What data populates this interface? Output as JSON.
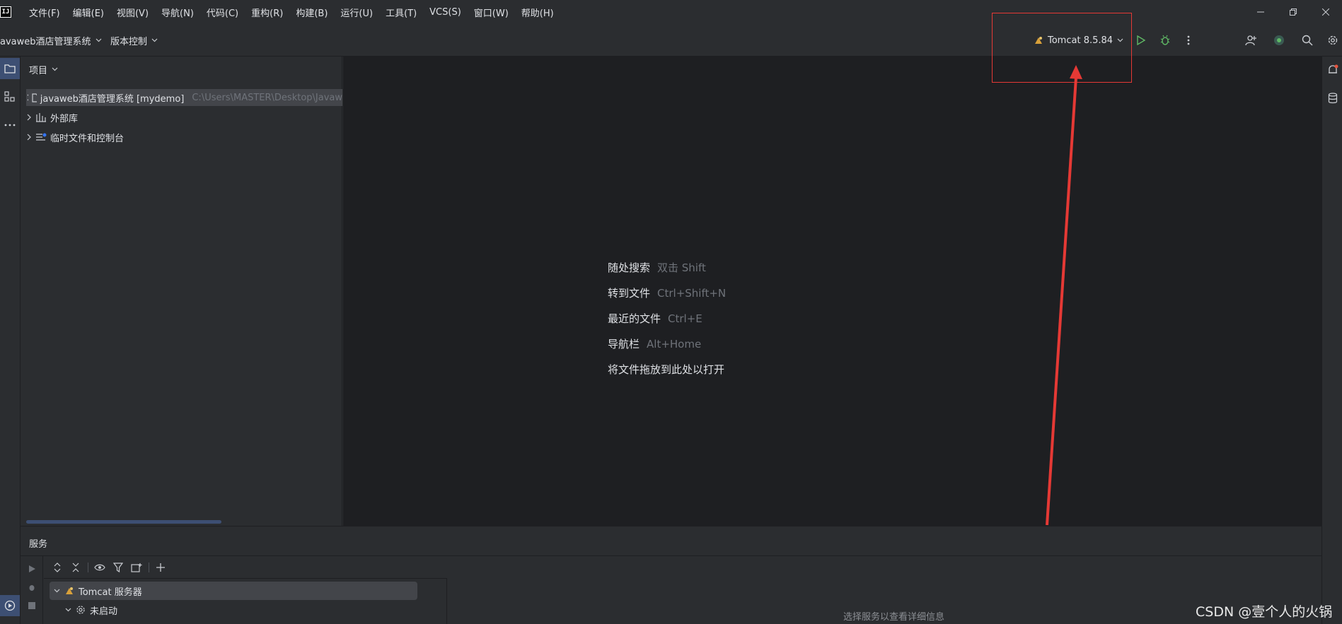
{
  "app": {
    "logo": "IJ"
  },
  "menu": [
    {
      "label": "文件(F)"
    },
    {
      "label": "编辑(E)"
    },
    {
      "label": "视图(V)"
    },
    {
      "label": "导航(N)"
    },
    {
      "label": "代码(C)"
    },
    {
      "label": "重构(R)"
    },
    {
      "label": "构建(B)"
    },
    {
      "label": "运行(U)"
    },
    {
      "label": "工具(T)"
    },
    {
      "label": "VCS(S)"
    },
    {
      "label": "窗口(W)"
    },
    {
      "label": "帮助(H)"
    }
  ],
  "toolbar": {
    "project_name": "avaweb酒店管理系统",
    "vcs_label": "版本控制",
    "run_config": "Tomcat 8.5.84",
    "icons": [
      "run-icon",
      "debug-icon",
      "more-icon",
      "add-user-icon",
      "code-with-me-icon",
      "search-icon",
      "settings-icon"
    ]
  },
  "project_panel": {
    "title": "项目",
    "tree": [
      {
        "label": "javaweb酒店管理系统 [mydemo]",
        "path": "C:\\Users\\MASTER\\Desktop\\Javaw",
        "icon": "module-folder-icon"
      },
      {
        "label": "外部库",
        "icon": "library-icon"
      },
      {
        "label": "临时文件和控制台",
        "icon": "scratches-icon"
      }
    ]
  },
  "editor": {
    "hints": [
      {
        "label": "随处搜索",
        "key": "双击 Shift"
      },
      {
        "label": "转到文件",
        "key": "Ctrl+Shift+N"
      },
      {
        "label": "最近的文件",
        "key": "Ctrl+E"
      },
      {
        "label": "导航栏",
        "key": "Alt+Home"
      },
      {
        "label": "将文件拖放到此处以打开",
        "key": ""
      }
    ]
  },
  "services": {
    "title": "服务",
    "tree": [
      {
        "label": "Tomcat 服务器",
        "icon": "tomcat-icon"
      },
      {
        "label": "未启动",
        "icon": "gear-icon"
      }
    ],
    "detail_placeholder": "选择服务以查看详细信息"
  },
  "watermark": "CSDN @壹个人的火锅",
  "colors": {
    "background": "#2b2d30",
    "editor_bg": "#1e1f22",
    "accent": "#3574f0",
    "run_green": "#5fb865",
    "annotation_red": "#e53935"
  }
}
